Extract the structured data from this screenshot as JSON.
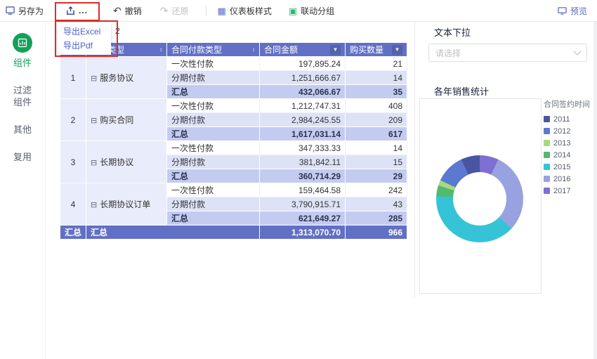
{
  "toolbar": {
    "save_as_label": "另存为",
    "export_button_label": "...",
    "export_menu": [
      {
        "label": "导出Excel"
      },
      {
        "label": "导出Pdf"
      }
    ],
    "undo_label": "撤销",
    "redo_label": "还原",
    "dashboard_style_label": "仪表板样式",
    "linkage_group_label": "联动分组",
    "preview_label": "预览",
    "stray_text": "2"
  },
  "icons": {
    "sort_filter": "↕",
    "column_dropdown": "▼",
    "collapse": "⊟",
    "undo_arrow": "↶",
    "redo_arrow": "↷",
    "grid": "▦",
    "linkage": "▣"
  },
  "sidebar": {
    "items": [
      {
        "label": "组件",
        "active": true
      },
      {
        "label": "过滤组件",
        "active": false
      },
      {
        "label": "其他",
        "active": false
      },
      {
        "label": "复用",
        "active": false
      }
    ]
  },
  "table": {
    "headers": {
      "index": "",
      "group": "合同类型",
      "payment": "合同付款类型",
      "amount": "合同金额",
      "qty": "购买数量"
    },
    "subtotal_label": "汇总",
    "collapse_icon": "⊟",
    "groups": [
      {
        "index": "1",
        "name": "服务协议",
        "rows": [
          {
            "type": "一次性付款",
            "amount": "197,895.24",
            "qty": "21"
          },
          {
            "type": "分期付款",
            "amount": "1,251,666.67",
            "qty": "14"
          },
          {
            "type": "汇总",
            "amount": "432,066.67",
            "qty": "35"
          }
        ]
      },
      {
        "index": "2",
        "name": "购买合同",
        "rows": [
          {
            "type": "一次性付款",
            "amount": "1,212,747.31",
            "qty": "408"
          },
          {
            "type": "分期付款",
            "amount": "2,984,245.55",
            "qty": "209"
          },
          {
            "type": "汇总",
            "amount": "1,617,031.14",
            "qty": "617"
          }
        ]
      },
      {
        "index": "3",
        "name": "长期协议",
        "rows": [
          {
            "type": "一次性付款",
            "amount": "347,333.33",
            "qty": "14"
          },
          {
            "type": "分期付款",
            "amount": "381,842.11",
            "qty": "15"
          },
          {
            "type": "汇总",
            "amount": "360,714.29",
            "qty": "29"
          }
        ]
      },
      {
        "index": "4",
        "name": "长期协议订单",
        "rows": [
          {
            "type": "一次性付款",
            "amount": "159,464.58",
            "qty": "242"
          },
          {
            "type": "分期付款",
            "amount": "3,790,915.71",
            "qty": "43"
          },
          {
            "type": "汇总",
            "amount": "621,649.27",
            "qty": "285"
          }
        ]
      }
    ],
    "total": {
      "index_label": "汇总",
      "group_label": "汇总",
      "amount": "1,313,070.70",
      "qty": "966"
    }
  },
  "filter_widget": {
    "title": "文本下拉",
    "placeholder": "请选择"
  },
  "chart_widget": {
    "title": "各年销售统计"
  },
  "chart_data": {
    "type": "pie",
    "donut": true,
    "title": "各年销售统计",
    "legend_title": "合同签约时间",
    "legend_position": "right",
    "categories": [
      "2011",
      "2012",
      "2013",
      "2014",
      "2015",
      "2016",
      "2017"
    ],
    "values": [
      7,
      11,
      2,
      4,
      39,
      30,
      7
    ],
    "values_are_estimated_percent_shares": true,
    "colors": [
      "#4a55a2",
      "#5b79d0",
      "#a8d97e",
      "#53b96d",
      "#35c4d7",
      "#98a2e0",
      "#7f6fd1"
    ]
  },
  "colors": {
    "accent_blue": "#6170c5",
    "row_alt": "#dde2f7",
    "row_subtotal": "#c4cbf0",
    "row_group": "#e9ecfa",
    "annotation_red": "#e02b2b",
    "menu_link": "#4c5fc4",
    "sidebar_active_green": "#14a05a"
  }
}
